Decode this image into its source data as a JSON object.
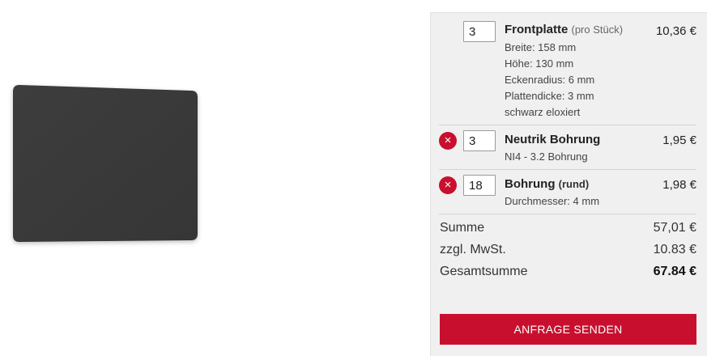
{
  "cart": {
    "items": [
      {
        "qty": "3",
        "name": "Frontplatte",
        "name_sub": "(pro Stück)",
        "price": "10,36 €",
        "details": [
          "Breite: 158 mm",
          "Höhe: 130 mm",
          "Eckenradius: 6 mm",
          "Plattendicke: 3 mm",
          "schwarz eloxiert"
        ],
        "removable": false
      },
      {
        "qty": "3",
        "name": "Neutrik Bohrung",
        "price": "1,95 €",
        "details": [
          "NI4 - 3.2 Bohrung"
        ],
        "removable": true
      },
      {
        "qty": "18",
        "name": "Bohrung",
        "name_suffix": "(rund)",
        "price": "1,98 €",
        "details": [
          "Durchmesser: 4 mm"
        ],
        "removable": true
      }
    ],
    "remove_icon": "×",
    "summary": {
      "subtotal_label": "Summe",
      "subtotal_value": "57,01 €",
      "tax_label": "zzgl. MwSt.",
      "tax_value": "10.83 €",
      "total_label": "Gesamtsumme",
      "total_value": "67.84 €"
    },
    "send_button": "ANFRAGE SENDEN"
  },
  "colors": {
    "accent": "#c8102e",
    "panel": "#3a3a3a",
    "sidebar_bg": "#f0f0f0"
  },
  "icons": {
    "remove": "close-circle-icon"
  }
}
